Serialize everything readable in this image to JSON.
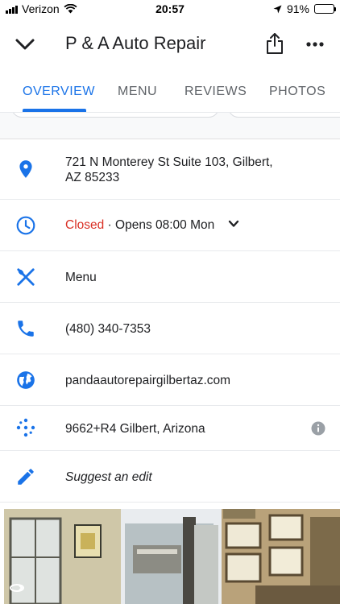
{
  "status_bar": {
    "carrier": "Verizon",
    "time": "20:57",
    "battery": "91%",
    "battery_level": 0.91
  },
  "header": {
    "title": "P & A Auto Repair",
    "back_icon": "chevron-down-icon",
    "share_icon": "share-icon",
    "more_icon": "more-horizontal-icon"
  },
  "tabs": [
    {
      "label": "OVERVIEW",
      "active": true
    },
    {
      "label": "MENU",
      "active": false
    },
    {
      "label": "REVIEWS",
      "active": false
    },
    {
      "label": "PHOTOS",
      "active": false
    }
  ],
  "info": {
    "address_line1": "721 N Monterey St Suite 103, Gilbert,",
    "address_line2": "AZ 85233",
    "hours_status": "Closed",
    "hours_detail": " · Opens 08:00 Mon",
    "menu": "Menu",
    "phone": "(480) 340-7353",
    "website": "pandaautorepairgilbertaz.com",
    "plus_code": "9662+R4 Gilbert, Arizona",
    "suggest_edit": "Suggest an edit"
  },
  "colors": {
    "accent": "#1a73e8",
    "closed": "#d93025",
    "text": "#202124",
    "secondary": "#5f6368"
  }
}
